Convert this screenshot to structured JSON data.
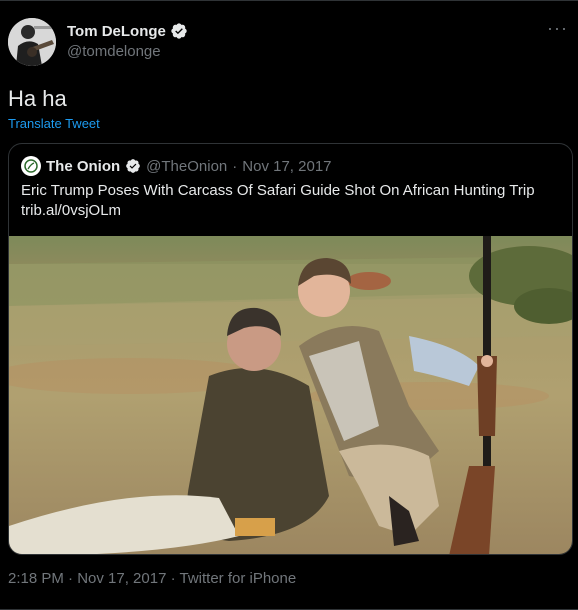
{
  "author": {
    "name": "Tom DeLonge",
    "handle": "@tomdelonge"
  },
  "tweet": {
    "text": "Ha ha",
    "translate_label": "Translate Tweet",
    "more_label": "···"
  },
  "quoted": {
    "name": "The Onion",
    "handle": "@TheOnion",
    "separator": "·",
    "date": "Nov 17, 2017",
    "text": "Eric Trump Poses With Carcass Of Safari Guide Shot On African Hunting Trip",
    "link": "trib.al/0vsjOLm"
  },
  "meta": {
    "timestamp": "2:18 PM · Nov 17, 2017 · Twitter for iPhone"
  },
  "colors": {
    "background": "#000000",
    "text": "#e7e9ea",
    "muted": "#71767b",
    "link": "#1d9bf0",
    "border": "#2f3336",
    "verified": "#ffffff"
  }
}
